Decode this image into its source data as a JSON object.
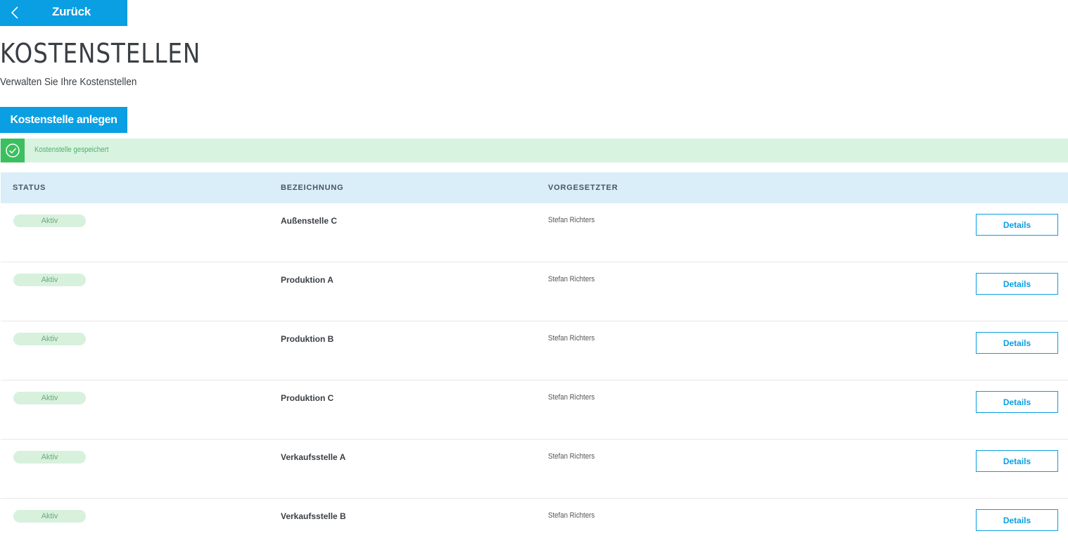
{
  "header": {
    "back_label": "Zurück",
    "title": "KOSTENSTELLEN",
    "subtitle": "Verwalten Sie Ihre Kostenstellen",
    "create_label": "Kostenstelle anlegen"
  },
  "alert": {
    "message": "Kostenstelle gespeichert",
    "icon": "check-circle-icon"
  },
  "table": {
    "columns": {
      "status": "STATUS",
      "name": "BEZEICHNUNG",
      "supervisor": "VORGESETZTER"
    },
    "rows": [
      {
        "status": "Aktiv",
        "name": "Außenstelle C",
        "supervisor": "Stefan Richters",
        "action": "Details"
      },
      {
        "status": "Aktiv",
        "name": "Produktion A",
        "supervisor": "Stefan Richters",
        "action": "Details"
      },
      {
        "status": "Aktiv",
        "name": "Produktion B",
        "supervisor": "Stefan Richters",
        "action": "Details"
      },
      {
        "status": "Aktiv",
        "name": "Produktion C",
        "supervisor": "Stefan Richters",
        "action": "Details"
      },
      {
        "status": "Aktiv",
        "name": "Verkaufsstelle A",
        "supervisor": "Stefan Richters",
        "action": "Details"
      },
      {
        "status": "Aktiv",
        "name": "Verkaufsstelle B",
        "supervisor": "Stefan Richters",
        "action": "Details"
      }
    ]
  },
  "colors": {
    "primary": "#0a9ee2",
    "success": "#3cbf5f",
    "alert_bg": "#d9f3e1",
    "table_header_bg": "#d9eef8",
    "badge_bg": "#d7f1dc"
  }
}
